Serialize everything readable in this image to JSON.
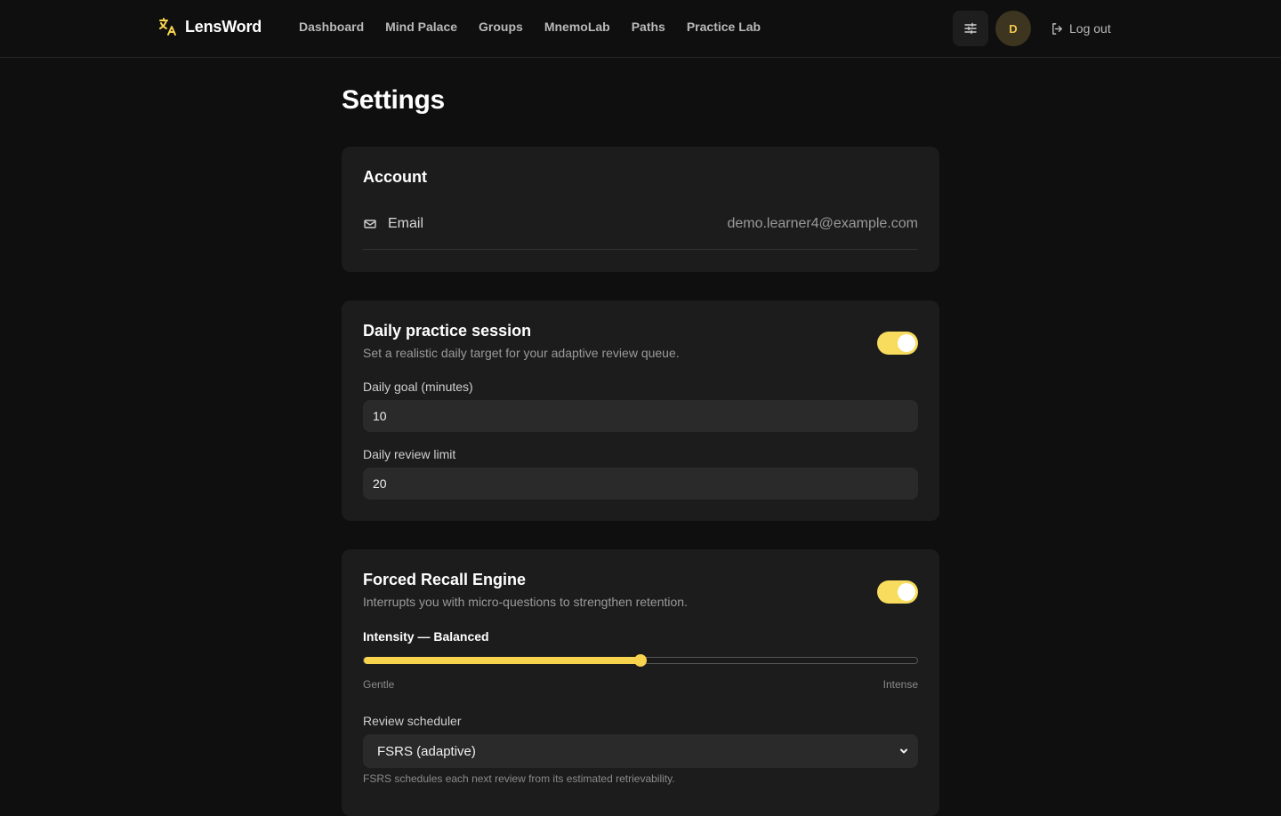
{
  "brand": {
    "name": "LensWord",
    "icon": "translate-icon",
    "accent": "#f7d34e"
  },
  "nav": {
    "links": [
      "Dashboard",
      "Mind Palace",
      "Groups",
      "MnemoLab",
      "Paths",
      "Practice Lab"
    ],
    "settings_icon": "sliders-icon",
    "avatar_initial": "D",
    "logout_label": "Log out",
    "logout_icon": "logout-icon"
  },
  "page": {
    "title": "Settings"
  },
  "account": {
    "title": "Account",
    "email_label": "Email",
    "email_icon": "mail-icon",
    "email_value": "demo.learner4@example.com"
  },
  "daily": {
    "title": "Daily practice session",
    "description": "Set a realistic daily target for your adaptive review queue.",
    "enabled": true,
    "goal_label": "Daily goal (minutes)",
    "goal_value": "10",
    "limit_label": "Daily review limit",
    "limit_value": "20"
  },
  "recall": {
    "title": "Forced Recall Engine",
    "description": "Interrupts you with micro-questions to strengthen retention.",
    "enabled": true,
    "intensity_label": "Intensity — Balanced",
    "intensity_fraction": 0.5,
    "min_label": "Gentle",
    "max_label": "Intense",
    "scheduler_label": "Review scheduler",
    "scheduler_value": "FSRS (adaptive)",
    "scheduler_hint": "FSRS schedules each next review from its estimated retrievability."
  }
}
